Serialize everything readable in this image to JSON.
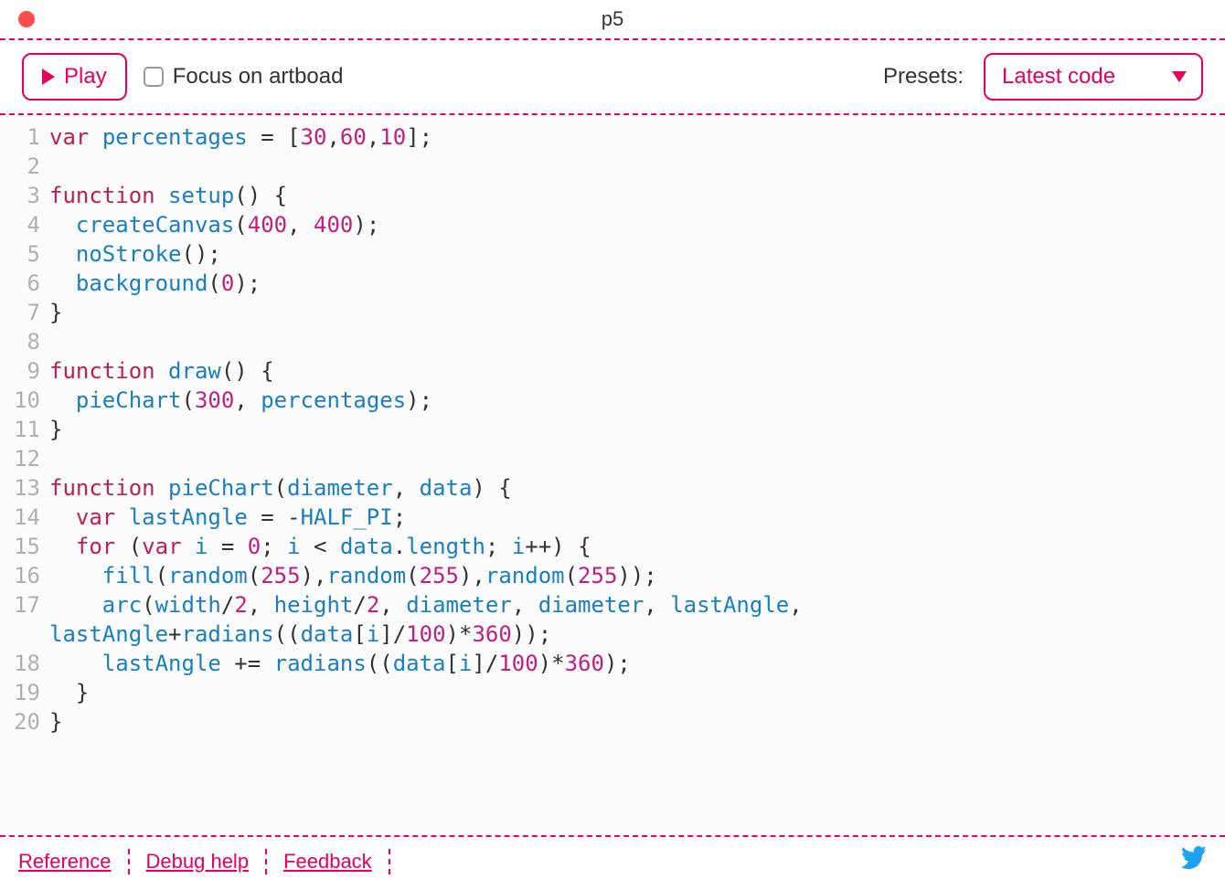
{
  "window": {
    "title": "p5"
  },
  "toolbar": {
    "play_label": "Play",
    "focus_label": "Focus on artboad",
    "presets_label": "Presets:",
    "presets_selected": "Latest code"
  },
  "code": {
    "lines": [
      {
        "n": 1,
        "tokens": [
          [
            "kw",
            "var"
          ],
          [
            "op",
            " "
          ],
          [
            "fn",
            "percentages"
          ],
          [
            "op",
            " = ["
          ],
          [
            "num",
            "30"
          ],
          [
            "op",
            ","
          ],
          [
            "num",
            "60"
          ],
          [
            "op",
            ","
          ],
          [
            "num",
            "10"
          ],
          [
            "op",
            "];"
          ]
        ]
      },
      {
        "n": 2,
        "tokens": []
      },
      {
        "n": 3,
        "tokens": [
          [
            "kw",
            "function"
          ],
          [
            "op",
            " "
          ],
          [
            "fn",
            "setup"
          ],
          [
            "op",
            "() {"
          ]
        ]
      },
      {
        "n": 4,
        "tokens": [
          [
            "op",
            "  "
          ],
          [
            "fn",
            "createCanvas"
          ],
          [
            "op",
            "("
          ],
          [
            "num",
            "400"
          ],
          [
            "op",
            ", "
          ],
          [
            "num",
            "400"
          ],
          [
            "op",
            ");"
          ]
        ]
      },
      {
        "n": 5,
        "tokens": [
          [
            "op",
            "  "
          ],
          [
            "fn",
            "noStroke"
          ],
          [
            "op",
            "();"
          ]
        ]
      },
      {
        "n": 6,
        "tokens": [
          [
            "op",
            "  "
          ],
          [
            "fn",
            "background"
          ],
          [
            "op",
            "("
          ],
          [
            "num",
            "0"
          ],
          [
            "op",
            ");"
          ]
        ]
      },
      {
        "n": 7,
        "tokens": [
          [
            "op",
            "}"
          ]
        ]
      },
      {
        "n": 8,
        "tokens": []
      },
      {
        "n": 9,
        "tokens": [
          [
            "kw",
            "function"
          ],
          [
            "op",
            " "
          ],
          [
            "fn",
            "draw"
          ],
          [
            "op",
            "() {"
          ]
        ]
      },
      {
        "n": 10,
        "tokens": [
          [
            "op",
            "  "
          ],
          [
            "fn",
            "pieChart"
          ],
          [
            "op",
            "("
          ],
          [
            "num",
            "300"
          ],
          [
            "op",
            ", "
          ],
          [
            "fn",
            "percentages"
          ],
          [
            "op",
            ");"
          ]
        ]
      },
      {
        "n": 11,
        "tokens": [
          [
            "op",
            "}"
          ]
        ]
      },
      {
        "n": 12,
        "tokens": []
      },
      {
        "n": 13,
        "tokens": [
          [
            "kw",
            "function"
          ],
          [
            "op",
            " "
          ],
          [
            "fn",
            "pieChart"
          ],
          [
            "op",
            "("
          ],
          [
            "fn",
            "diameter"
          ],
          [
            "op",
            ", "
          ],
          [
            "fn",
            "data"
          ],
          [
            "op",
            ") {"
          ]
        ]
      },
      {
        "n": 14,
        "tokens": [
          [
            "op",
            "  "
          ],
          [
            "kw",
            "var"
          ],
          [
            "op",
            " "
          ],
          [
            "fn",
            "lastAngle"
          ],
          [
            "op",
            " = -"
          ],
          [
            "fn",
            "HALF_PI"
          ],
          [
            "op",
            ";"
          ]
        ]
      },
      {
        "n": 15,
        "tokens": [
          [
            "op",
            "  "
          ],
          [
            "kw",
            "for"
          ],
          [
            "op",
            " ("
          ],
          [
            "kw",
            "var"
          ],
          [
            "op",
            " "
          ],
          [
            "fn",
            "i"
          ],
          [
            "op",
            " = "
          ],
          [
            "num",
            "0"
          ],
          [
            "op",
            "; "
          ],
          [
            "fn",
            "i"
          ],
          [
            "op",
            " < "
          ],
          [
            "fn",
            "data"
          ],
          [
            "op",
            "."
          ],
          [
            "fn",
            "length"
          ],
          [
            "op",
            "; "
          ],
          [
            "fn",
            "i"
          ],
          [
            "op",
            "++) {"
          ]
        ]
      },
      {
        "n": 16,
        "tokens": [
          [
            "op",
            "    "
          ],
          [
            "fn",
            "fill"
          ],
          [
            "op",
            "("
          ],
          [
            "fn",
            "random"
          ],
          [
            "op",
            "("
          ],
          [
            "num",
            "255"
          ],
          [
            "op",
            "),"
          ],
          [
            "fn",
            "random"
          ],
          [
            "op",
            "("
          ],
          [
            "num",
            "255"
          ],
          [
            "op",
            "),"
          ],
          [
            "fn",
            "random"
          ],
          [
            "op",
            "("
          ],
          [
            "num",
            "255"
          ],
          [
            "op",
            "));"
          ]
        ]
      },
      {
        "n": 17,
        "tokens": [
          [
            "op",
            "    "
          ],
          [
            "fn",
            "arc"
          ],
          [
            "op",
            "("
          ],
          [
            "fn",
            "width"
          ],
          [
            "op",
            "/"
          ],
          [
            "num",
            "2"
          ],
          [
            "op",
            ", "
          ],
          [
            "fn",
            "height"
          ],
          [
            "op",
            "/"
          ],
          [
            "num",
            "2"
          ],
          [
            "op",
            ", "
          ],
          [
            "fn",
            "diameter"
          ],
          [
            "op",
            ", "
          ],
          [
            "fn",
            "diameter"
          ],
          [
            "op",
            ", "
          ],
          [
            "fn",
            "lastAngle"
          ],
          [
            "op",
            ", "
          ],
          [
            "fn",
            "lastAngle"
          ],
          [
            "op",
            "+"
          ],
          [
            "fn",
            "radians"
          ],
          [
            "op",
            "(("
          ],
          [
            "fn",
            "data"
          ],
          [
            "op",
            "["
          ],
          [
            "fn",
            "i"
          ],
          [
            "op",
            "]/"
          ],
          [
            "num",
            "100"
          ],
          [
            "op",
            ")*"
          ],
          [
            "num",
            "360"
          ],
          [
            "op",
            "));"
          ]
        ]
      },
      {
        "n": 18,
        "tokens": [
          [
            "op",
            "    "
          ],
          [
            "fn",
            "lastAngle"
          ],
          [
            "op",
            " += "
          ],
          [
            "fn",
            "radians"
          ],
          [
            "op",
            "(("
          ],
          [
            "fn",
            "data"
          ],
          [
            "op",
            "["
          ],
          [
            "fn",
            "i"
          ],
          [
            "op",
            "]/"
          ],
          [
            "num",
            "100"
          ],
          [
            "op",
            ")*"
          ],
          [
            "num",
            "360"
          ],
          [
            "op",
            ");"
          ]
        ]
      },
      {
        "n": 19,
        "tokens": [
          [
            "op",
            "  }"
          ]
        ]
      },
      {
        "n": 20,
        "tokens": [
          [
            "op",
            "}"
          ]
        ]
      }
    ]
  },
  "footer": {
    "links": [
      "Reference",
      "Debug help",
      "Feedback"
    ]
  }
}
